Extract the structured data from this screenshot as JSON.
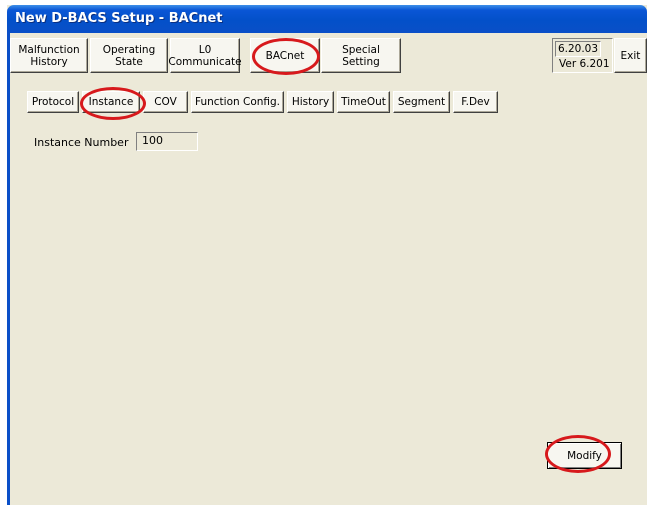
{
  "window": {
    "title": "New D-BACS Setup - BACnet"
  },
  "top_tabs": [
    {
      "line1": "Malfunction",
      "line2": "History"
    },
    {
      "line1": "Operating",
      "line2": "State"
    },
    {
      "line1": "L0",
      "line2": "Communicate"
    },
    {
      "line1": "BACnet",
      "line2": ""
    },
    {
      "line1": "Special",
      "line2": "Setting"
    }
  ],
  "version": {
    "value": "6.20.03",
    "label": "Ver 6.201"
  },
  "exit_label": "Exit",
  "sub_tabs": [
    "Protocol",
    "Instance",
    "COV",
    "Function Config.",
    "History",
    "TimeOut",
    "Segment",
    "F.Dev"
  ],
  "instance": {
    "label": "Instance Number",
    "value": "100"
  },
  "modify_label": "Modify",
  "colors": {
    "titlebar": "#0a56d6",
    "dialog_bg": "#ece9d8",
    "annotation": "#d7191c"
  }
}
